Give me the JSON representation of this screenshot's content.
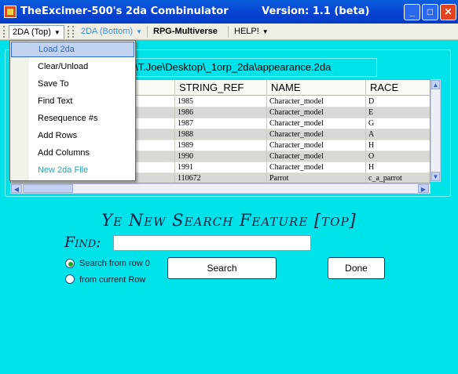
{
  "window": {
    "title": "TheExcimer-500's 2da Combinulator",
    "version": "Version: 1.1  (beta)",
    "controls": {
      "minimize": "_",
      "maximize": "□",
      "close": "✕"
    }
  },
  "menubar": {
    "items": [
      {
        "label": "2DA (Top)"
      },
      {
        "label": "2DA (Bottom)"
      },
      {
        "label": "RPG-Multiverse"
      },
      {
        "label": "HELP!"
      }
    ]
  },
  "dropdown": {
    "items": [
      {
        "label": "Load 2da"
      },
      {
        "label": "Clear/Unload"
      },
      {
        "label": "Save To"
      },
      {
        "label": "Find Text"
      },
      {
        "label": "Resequence #s"
      },
      {
        "label": "Add Rows"
      },
      {
        "label": "Add Columns"
      },
      {
        "label": "New 2da File"
      }
    ]
  },
  "path": "\\T.Joe\\Desktop\\_1orp_2da\\appearance.2da",
  "grid": {
    "columns": [
      "STRING_REF",
      "NAME",
      "RACE"
    ],
    "rows": [
      [
        "1985",
        "Character_model",
        "D"
      ],
      [
        "1986",
        "Character_model",
        "E"
      ],
      [
        "1987",
        "Character_model",
        "G"
      ],
      [
        "1988",
        "Character_model",
        "A"
      ],
      [
        "1989",
        "Character_model",
        "H"
      ],
      [
        "1990",
        "Character_model",
        "O"
      ],
      [
        "1991",
        "Character_model",
        "H"
      ],
      [
        "110672",
        "Parrot",
        "c_a_parrot"
      ]
    ]
  },
  "search": {
    "title": "Ye New Search Feature [top]",
    "find_label": "Find:",
    "find_value": "",
    "radio_from_row0": "Search from row 0",
    "radio_current": "from current Row",
    "search_button": "Search",
    "done_button": "Done"
  },
  "colors": {
    "background": "#00e2e9",
    "titlebar": "#0a46d6",
    "selected": "#c1d2ee"
  }
}
